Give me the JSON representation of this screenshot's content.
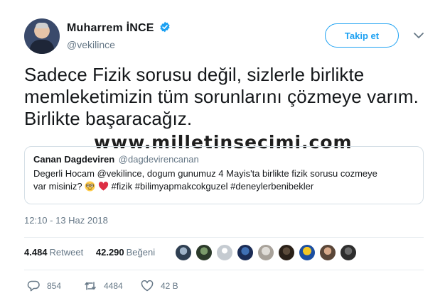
{
  "author": {
    "display_name": "Muharrem İNCE",
    "handle": "@vekilince",
    "follow_label": "Takip et"
  },
  "tweet": {
    "text": "Sadece Fizik sorusu değil, sizlerle birlikte memleketimizin tüm sorunlarını çözmeye varım. Birlikte başaracağız."
  },
  "watermark": "www.milletinsecimi.com",
  "quote": {
    "name": "Canan Dagdeviren",
    "handle": "@dagdevirencanan",
    "text_line1": "Degerli Hocam @vekilince, dogum gunumuz 4 Mayis'ta birlikte fizik sorusu cozmeye",
    "text_line2_start": "var misiniz?",
    "hashtags": "#fizik #bilimyapmakcokguzel #deneylerbenibekler"
  },
  "timestamp": "12:10 - 13 Haz 2018",
  "stats": {
    "retweet_count": "4.484",
    "retweet_label": "Retweet",
    "like_count": "42.290",
    "like_label": "Beğeni"
  },
  "actions": {
    "reply_count": "854",
    "retweet_count": "4484",
    "like_count": "42 B"
  },
  "colors": {
    "accent": "#1da1f2",
    "muted": "#657786",
    "text": "#14171a",
    "border": "#e6ecf0"
  },
  "icons": [
    "verified-badge-icon",
    "chevron-down-icon",
    "reply-icon",
    "retweet-icon",
    "like-heart-icon",
    "nerd-face-emoji",
    "red-heart-emoji"
  ]
}
